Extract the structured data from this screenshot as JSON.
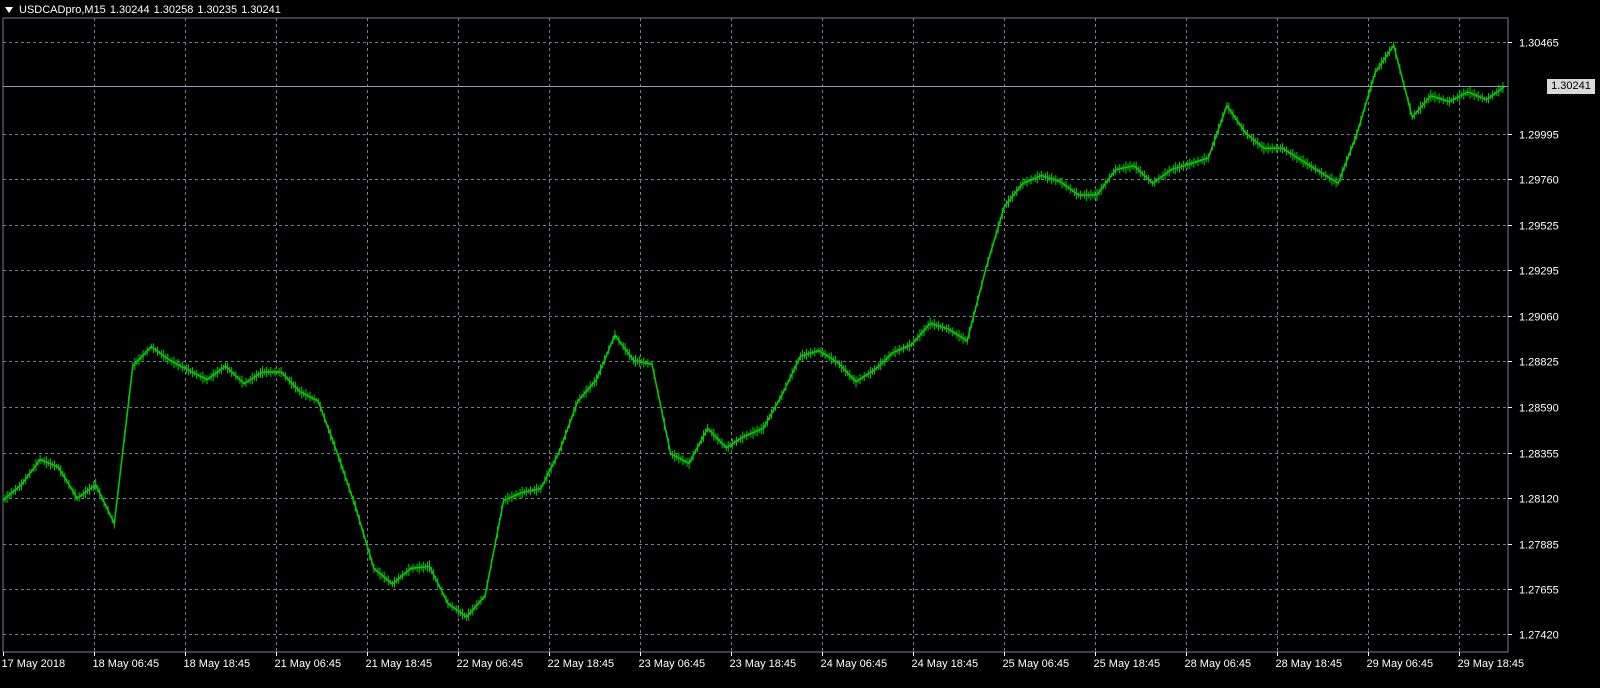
{
  "header": {
    "symbol_timeframe": "USDCADpro,M15",
    "open": "1.30244",
    "high": "1.30258",
    "low": "1.30235",
    "close": "1.30241"
  },
  "price_axis": {
    "labels": [
      "1.30465",
      "1.29995",
      "1.29760",
      "1.29525",
      "1.29295",
      "1.29060",
      "1.28825",
      "1.28590",
      "1.28355",
      "1.28120",
      "1.27885",
      "1.27655",
      "1.27420"
    ],
    "current_price": "1.30241"
  },
  "time_axis": {
    "labels": [
      "17 May 2018",
      "18 May 06:45",
      "18 May 18:45",
      "21 May 06:45",
      "21 May 18:45",
      "22 May 06:45",
      "22 May 18:45",
      "23 May 06:45",
      "23 May 18:45",
      "24 May 06:45",
      "24 May 18:45",
      "25 May 06:45",
      "25 May 18:45",
      "28 May 06:45",
      "28 May 18:45",
      "29 May 06:45",
      "29 May 18:45"
    ]
  },
  "colors": {
    "background": "#000000",
    "bars": "#00d000",
    "grid": "#6f7f8f",
    "axis_text": "#ffffff",
    "price_line": "#8fa0b0",
    "price_label_bg": "#d9d9d9"
  },
  "chart_data": {
    "type": "line",
    "series": [
      {
        "values": [
          [
            "17 May 2018",
            1.2811
          ],
          [
            "17 May",
            1.2819
          ],
          [
            "17 May",
            1.2832
          ],
          [
            "17 May",
            1.2828
          ],
          [
            "17 May",
            1.2812
          ],
          [
            "18 May 06:45",
            1.2819
          ],
          [
            "18 May",
            1.2799
          ],
          [
            "18 May",
            1.288
          ],
          [
            "18 May",
            1.289
          ],
          [
            "18 May",
            1.2883
          ],
          [
            "18 May 18:45",
            1.2878
          ],
          [
            "18 May",
            1.2873
          ],
          [
            "18 May",
            1.288
          ],
          [
            "18 May",
            1.2871
          ],
          [
            "18 May",
            1.2877
          ],
          [
            "21 May 06:45",
            1.2877
          ],
          [
            "21 May",
            1.2867
          ],
          [
            "21 May",
            1.2862
          ],
          [
            "21 May",
            1.2836
          ],
          [
            "21 May",
            1.2808
          ],
          [
            "21 May 18:45",
            1.2776
          ],
          [
            "21 May",
            1.2768
          ],
          [
            "21 May",
            1.2776
          ],
          [
            "21 May",
            1.2777
          ],
          [
            "21 May",
            1.2758
          ],
          [
            "22 May 06:45",
            1.2751
          ],
          [
            "22 May",
            1.2762
          ],
          [
            "22 May",
            1.2811
          ],
          [
            "22 May",
            1.2815
          ],
          [
            "22 May",
            1.2817
          ],
          [
            "22 May 18:45",
            1.2836
          ],
          [
            "22 May",
            1.2862
          ],
          [
            "22 May",
            1.2873
          ],
          [
            "22 May",
            1.2896
          ],
          [
            "22 May",
            1.2883
          ],
          [
            "23 May 06:45",
            1.2881
          ],
          [
            "23 May",
            1.2835
          ],
          [
            "23 May",
            1.283
          ],
          [
            "23 May",
            1.2848
          ],
          [
            "23 May",
            1.2838
          ],
          [
            "23 May 18:45",
            1.2844
          ],
          [
            "23 May",
            1.2848
          ],
          [
            "23 May",
            1.2865
          ],
          [
            "23 May",
            1.2885
          ],
          [
            "23 May",
            1.2888
          ],
          [
            "24 May 06:45",
            1.2882
          ],
          [
            "24 May",
            1.2872
          ],
          [
            "24 May",
            1.2878
          ],
          [
            "24 May",
            1.2887
          ],
          [
            "24 May",
            1.2891
          ],
          [
            "24 May 18:45",
            1.2902
          ],
          [
            "24 May",
            1.2899
          ],
          [
            "24 May",
            1.2893
          ],
          [
            "24 May",
            1.293
          ],
          [
            "24 May",
            1.2962
          ],
          [
            "25 May 06:45",
            1.2974
          ],
          [
            "25 May",
            1.2978
          ],
          [
            "25 May",
            1.2975
          ],
          [
            "25 May",
            1.2968
          ],
          [
            "25 May",
            1.2968
          ],
          [
            "25 May 18:45",
            1.2981
          ],
          [
            "25 May",
            1.2983
          ],
          [
            "25 May",
            1.2974
          ],
          [
            "25 May",
            1.2981
          ],
          [
            "25 May",
            1.2984
          ],
          [
            "28 May 06:45",
            1.2987
          ],
          [
            "28 May",
            1.3014
          ],
          [
            "28 May",
            1.3
          ],
          [
            "28 May",
            1.2992
          ],
          [
            "28 May",
            1.2992
          ],
          [
            "28 May 18:45",
            1.2986
          ],
          [
            "28 May",
            1.298
          ],
          [
            "28 May",
            1.2974
          ],
          [
            "28 May",
            1.2999
          ],
          [
            "28 May",
            1.3031
          ],
          [
            "29 May 06:45",
            1.3045
          ],
          [
            "29 May",
            1.3008
          ],
          [
            "29 May",
            1.3019
          ],
          [
            "29 May",
            1.3016
          ],
          [
            "29 May",
            1.3021
          ],
          [
            "29 May 18:45",
            1.3017
          ],
          [
            "29 May",
            1.3024
          ]
        ]
      }
    ],
    "ylim": [
      1.2733,
      1.3059
    ],
    "grid": true
  }
}
